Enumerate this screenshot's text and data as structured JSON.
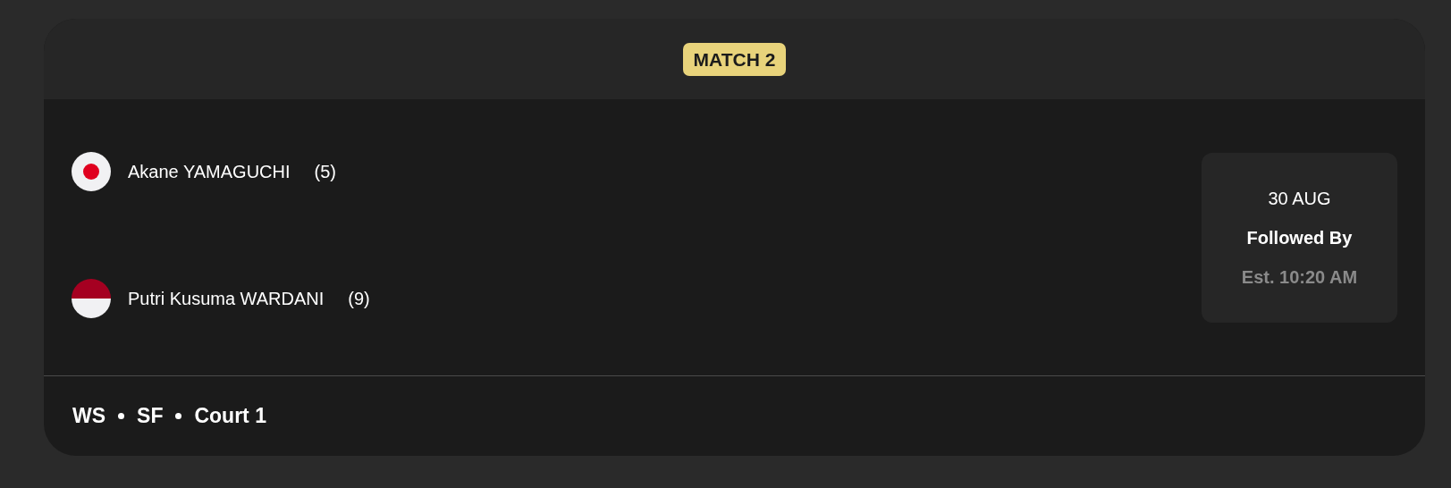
{
  "badge": "MATCH 2",
  "players": [
    {
      "kind": "japan",
      "name": "Akane YAMAGUCHI",
      "seed": "(5)"
    },
    {
      "kind": "indonesia",
      "name": "Putri Kusuma WARDANI",
      "seed": "(9)"
    }
  ],
  "schedule": {
    "date": "30 AUG",
    "label": "Followed By",
    "time": "Est. 10:20 AM"
  },
  "footer": [
    "WS",
    "SF",
    "Court 1"
  ]
}
